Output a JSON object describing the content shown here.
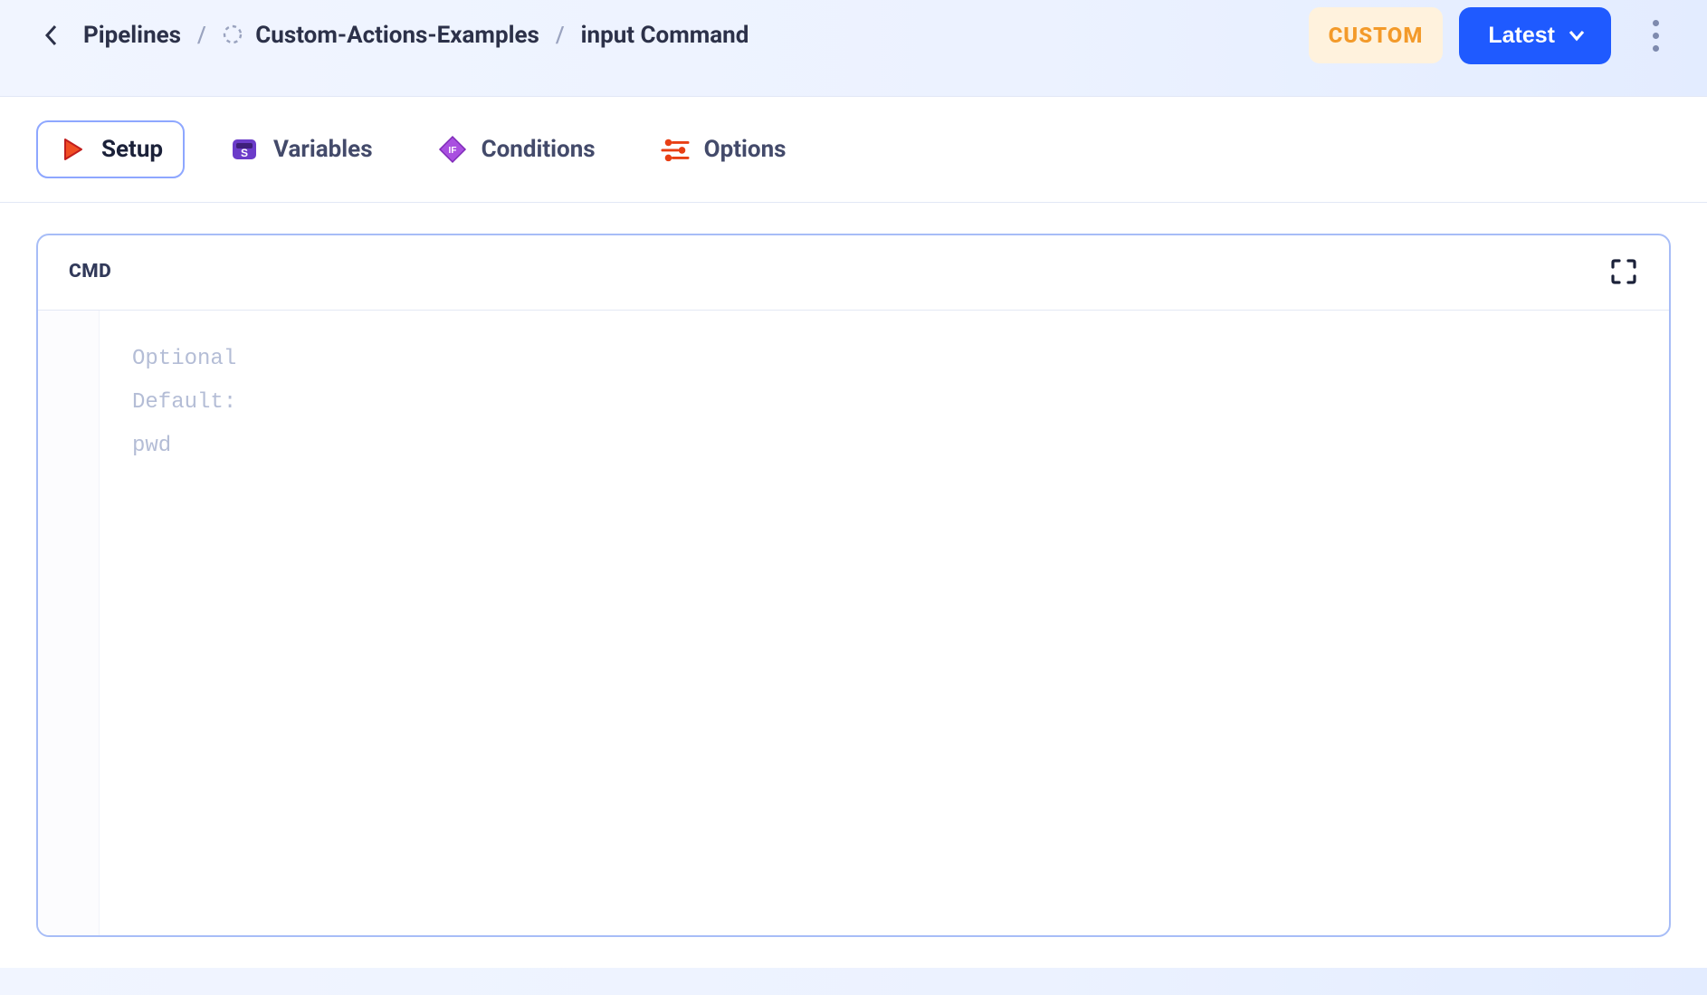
{
  "breadcrumb": {
    "root": "Pipelines",
    "project": "Custom-Actions-Examples",
    "current": "input Command"
  },
  "header": {
    "badge": "CUSTOM",
    "version_label": "Latest"
  },
  "tabs": {
    "setup": "Setup",
    "variables": "Variables",
    "conditions": "Conditions",
    "options": "Options"
  },
  "cmd": {
    "label": "CMD",
    "placeholder_lines": [
      "Optional",
      "Default:",
      "pwd"
    ]
  }
}
